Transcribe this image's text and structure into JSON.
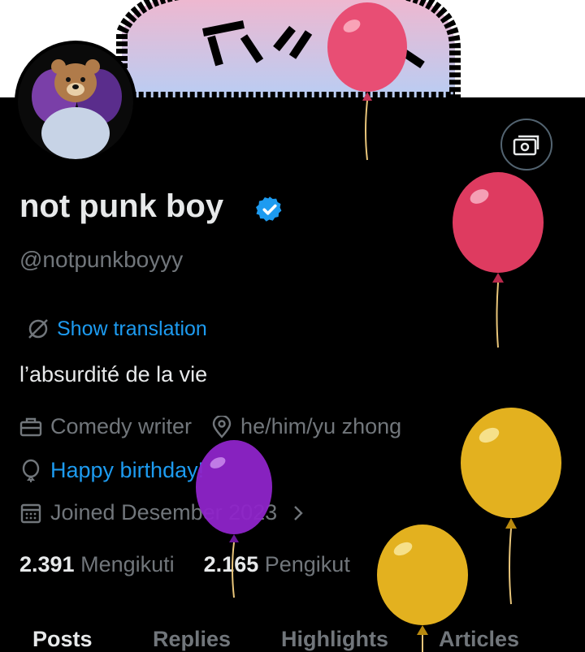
{
  "profile": {
    "display_name": "not punk boy",
    "handle": "@notpunkboyyy",
    "show_translation": "Show translation",
    "bio": "l’absurdité de la vie",
    "profession": "Comedy writer",
    "location": "he/him/yu zhong",
    "birthday": "Happy birthday!",
    "joined": "Joined Desember 2023"
  },
  "stats": {
    "following_count": "2.391",
    "following_label": "Mengikuti",
    "followers_count": "2.165",
    "followers_label": "Pengikut"
  },
  "tabs": [
    "Posts",
    "Replies",
    "Highlights",
    "Articles"
  ],
  "colors": {
    "background": "#000000",
    "accent": "#1d9bf0",
    "muted": "#71767b",
    "text": "#e7e9ea"
  },
  "icons": [
    "verified-badge-icon",
    "tip-icon",
    "translate-icon",
    "briefcase-icon",
    "location-pin-icon",
    "balloon-icon",
    "calendar-icon",
    "chevron-right-icon"
  ]
}
